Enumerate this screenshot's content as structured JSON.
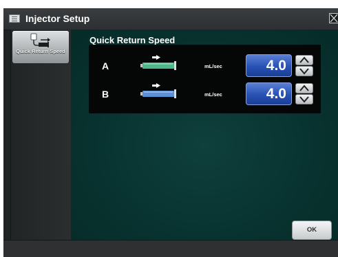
{
  "window": {
    "title": "Injector Setup",
    "title_icon": "list-icon",
    "close_icon": "close-icon"
  },
  "sidebar": {
    "items": [
      {
        "label": "Quick Return Speed",
        "icon": "quick-return-icon",
        "selected": true
      }
    ]
  },
  "main": {
    "section_title": "Quick Return Speed",
    "rows": [
      {
        "channel": "A",
        "unit": "mL/sec",
        "value": "4.0",
        "syringe_color": "#4fb58a",
        "icon": "syringe-icon"
      },
      {
        "channel": "B",
        "unit": "mL/sec",
        "value": "4.0",
        "syringe_color": "#5b8fd6",
        "icon": "syringe-icon"
      }
    ],
    "ok_label": "OK"
  },
  "colors": {
    "content_bg": "#083330",
    "value_box": "#2751b3",
    "panel_bg": "#050606"
  }
}
